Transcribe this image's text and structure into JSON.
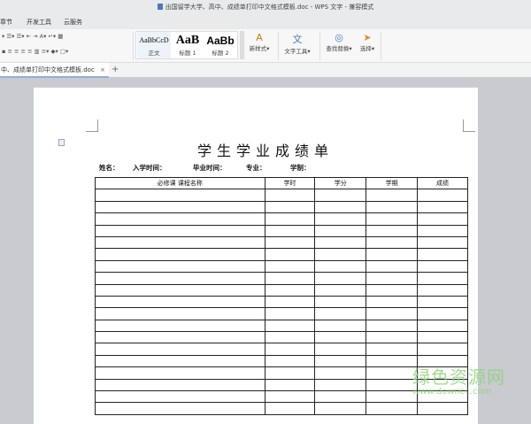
{
  "window": {
    "title": "出国留学大学、高中、成绩单打印中文格式模板.doc - WPS 文字 - 兼容模式"
  },
  "menu": [
    "章节",
    "开发工具",
    "云服务"
  ],
  "ribbon": {
    "styles": [
      {
        "sample": "AaBbCcD",
        "label": "正文"
      },
      {
        "sample": "AaB",
        "label": "标题 1"
      },
      {
        "sample": "AaBb",
        "label": "标题 2"
      }
    ],
    "new_style": "新样式",
    "text_tools": "文字工具",
    "find_replace": "查找替换",
    "select": "选择"
  },
  "tabs": {
    "doc": "中、成绩单打印中文格式模板.doc",
    "close": "×",
    "add": "+"
  },
  "document": {
    "title": "学生学业成绩单",
    "info": [
      "姓名：",
      "入学时间：",
      "毕业时间：",
      "专业：",
      "学制："
    ],
    "columns": [
      "必修课  课程名称",
      "学时",
      "学分",
      "学期",
      "成绩"
    ],
    "empty_rows": 19
  },
  "watermark": {
    "cn": "绿色资源网",
    "url": "www.downcc.com"
  }
}
